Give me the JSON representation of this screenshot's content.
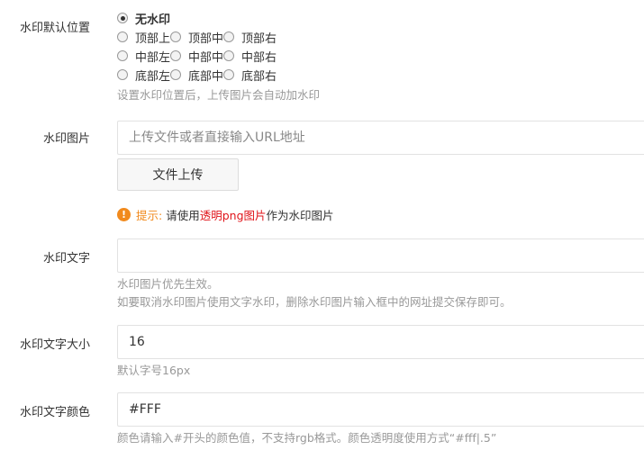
{
  "position": {
    "label": "水印默认位置",
    "options": [
      [
        "无水印"
      ],
      [
        "顶部上",
        "顶部中",
        "顶部右"
      ],
      [
        "中部左",
        "中部中",
        "中部右"
      ],
      [
        "底部左",
        "底部中",
        "底部右"
      ]
    ],
    "selected": "无水印",
    "help": "设置水印位置后，上传图片会自动加水印"
  },
  "image": {
    "label": "水印图片",
    "placeholder": "上传文件或者直接输入URL地址",
    "value": "",
    "upload_button": "文件上传",
    "tip": {
      "icon": "exclamation-icon",
      "label": "提示:",
      "before": "请使用",
      "highlight": "透明png图片",
      "after": "作为水印图片"
    }
  },
  "text": {
    "label": "水印文字",
    "value": "",
    "help1": "水印图片优先生效。",
    "help2": "如要取消水印图片使用文字水印，删除水印图片输入框中的网址提交保存即可。"
  },
  "size": {
    "label": "水印文字大小",
    "value": "16",
    "help": "默认字号16px"
  },
  "color": {
    "label": "水印文字颜色",
    "value": "#FFF",
    "help": "颜色请输入#开头的颜色值，不支持rgb格式。颜色透明度使用方式“#fff|.5”"
  },
  "colors": {
    "tip_orange": "#f18a1d",
    "tip_red": "#e0141a",
    "help_gray": "#999999"
  }
}
